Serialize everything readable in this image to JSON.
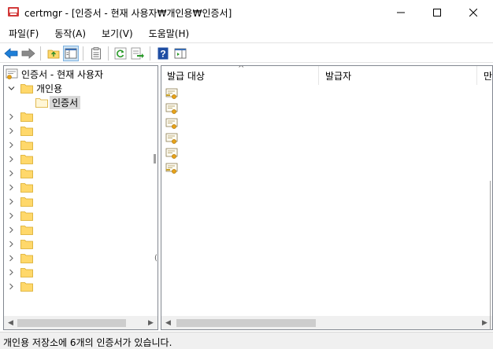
{
  "window": {
    "title": "certmgr - [인증서 - 현재 사용자₩개인용₩인증서]",
    "minimize_icon": "minimize-icon",
    "maximize_icon": "maximize-icon",
    "close_icon": "close-icon"
  },
  "menu": [
    "파일(F)",
    "동작(A)",
    "보기(V)",
    "도움말(H)"
  ],
  "toolbar": {
    "icons": [
      "back-arrow-icon",
      "forward-arrow-icon",
      "up-folder-icon",
      "show-hide-tree-icon",
      "properties-icon",
      "refresh-icon",
      "export-list-icon",
      "help-icon",
      "show-action-pane-icon"
    ]
  },
  "tree": {
    "root_label": "인증서 - 현재 사용자",
    "personal_label": "개인용",
    "certificates_label": "인증서",
    "collapsed_folders_count": 13
  },
  "list": {
    "columns": [
      "발급 대상",
      "발급자",
      "만"
    ],
    "sort_indicator": "^",
    "rows": [
      "",
      "",
      "",
      "",
      "",
      ""
    ]
  },
  "status": {
    "text": "개인용 저장소에 6개의 인증서가 있습니다."
  },
  "colors": {
    "folder_fill": "#ffd86b",
    "folder_edge": "#d9a927",
    "selection": "#d9d9d9",
    "back_arrow": "#1e7fd8",
    "help_blue": "#1f4ea3"
  }
}
